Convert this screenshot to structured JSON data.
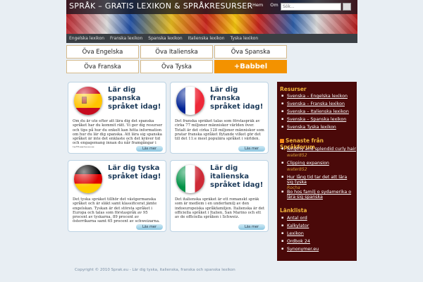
{
  "header": {
    "title": "SPRÅK – GRATIS LEXIKON & SPRÅKRESURSER",
    "top_nav": [
      "Hem",
      "Om"
    ],
    "search_placeholder": "Sök..."
  },
  "nav": [
    "Engelska lexikon",
    "Franska lexikon",
    "Spanska lexikon",
    "Italienska lexikon",
    "Tyska lexikon"
  ],
  "ads": [
    "Öva Engelska",
    "Öva Italienska",
    "Öva Spanska",
    "Öva Franska",
    "Öva Tyska",
    "+Babbel"
  ],
  "cards": [
    {
      "flag": "spain-flag-icon",
      "title": "Lär dig spanska språket idag!",
      "text": "Om du är ute efter att lära dig det spanska språket har du kommit rätt. Vi ger dig resurser och tips på hur du enkelt kan hitta information om hur du lär dig spanska. Att lära sig spanska språket är inte det enklaste och det kräver tid och engagemang innan du når framgångar i inlärningen.",
      "more": "Läs mer"
    },
    {
      "flag": "france-flag-icon",
      "title": "Lär dig franska språket idag!",
      "text": "Det franska språket talas som förstaspråk av cirka 77 miljoner människor världen över. Totalt är det cirka 128 miljoner människor som pratar franska språket flytande vilket gör det till det 11:e mest populära språket i världen.",
      "more": "Läs mer"
    },
    {
      "flag": "germany-flag-icon",
      "title": "Lär dig tyska språket idag!",
      "text": "Det tyska språket tillhör det västgermanska språket och är släkt samt klassificerat jämte engelskan. Tyskan är det största språket i Europa och talas som förstaspråk av 95 procent av tyskarna, 89 procent av österrikarna samt 65 procent av schweizarna.",
      "more": "Läs mer"
    },
    {
      "flag": "italy-flag-icon",
      "title": "Lär dig italienska språket idag!",
      "text": "Det italienska språket är ett romanskt språk som är medlem i en underfamilj av den indoeuropeiska språkfamiljen. Italienska är det officiella språket i Italien, San Marino och ett av de officiella språken i Schweiz.",
      "more": "Läs mer"
    }
  ],
  "sidebar": {
    "resources_title": "Resurser",
    "resources": [
      "Svenska – Engelska lexikon",
      "Svenska – Franska lexikon",
      "Svenska – Italienska lexikon",
      "Svenska – Spanska lexikon",
      "Svenska Tyska lexikon"
    ],
    "forum_title": "Senaste från Språkforum",
    "forum": [
      {
        "title": "lengthy and splendid curly hair",
        "author": "water852"
      },
      {
        "title": "Clipping expansion",
        "author": "water852"
      },
      {
        "title": "Hur lång tid tar det att lära sig tyska",
        "author": "Rocha"
      },
      {
        "title": "Bo hos familj o sydamerika o lära sig spanska",
        "author": ""
      }
    ],
    "links_title": "Länklista",
    "links": [
      "Antal ord",
      "Kalkylator",
      "Lexikon",
      "Ordbok 24",
      "Synonymer.eu"
    ]
  },
  "footer": "Copyright © 2010 Sprak.eu - Lär dig tyska, italienska, franska och spanska lexikon"
}
